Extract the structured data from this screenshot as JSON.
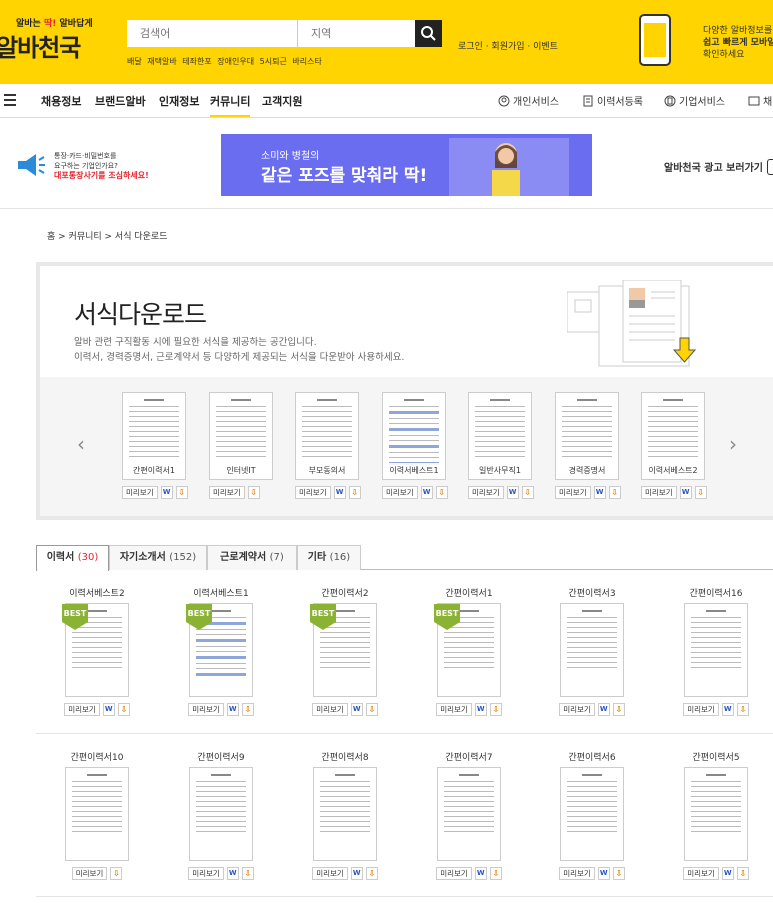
{
  "header": {
    "slogan_pre": "알바는 ",
    "slogan_red": "딱!",
    "slogan_post": " 알바답게",
    "logo": "알바천국",
    "search_placeholder": "검색어",
    "region_placeholder": "지역",
    "quick_links": [
      "배달",
      "재택알바",
      "테좌한포",
      "장애인우대",
      "5시퇴근",
      "바리스타"
    ],
    "account_links": "로그인 · 회원가입 · 이벤트",
    "promo_line1": "다양한 알바정보를",
    "promo_line2": "쉽고 빠르게 모바일",
    "promo_line3": "확인하세요"
  },
  "gnb": {
    "items": [
      "채용정보",
      "브랜드알바",
      "인재정보",
      "커뮤니티",
      "고객지원"
    ],
    "active": "커뮤니티",
    "right": [
      "개인서비스",
      "이력서등록",
      "기업서비스",
      "채"
    ]
  },
  "ad": {
    "warn_line1": "통장·카드·비밀번호를",
    "warn_line2": "요구하는 기업인가요?",
    "warn_line3": "대포통장사기를 조심하세요!",
    "banner_sub": "소미와 병철의",
    "banner_main": "같은 포즈를 맞춰라 딱!",
    "link": "알바천국 광고 보러가기"
  },
  "breadcrumb": "홈 > 커뮤니티 > 서식 다운로드",
  "hero": {
    "title": "서식다운로드",
    "desc1": "알바 관련 구직활동 시에 필요한 서식을 제공하는 공간입니다.",
    "desc2": "이력서, 경력증명서, 근로계약서 등 다양하게 제공되는 서식을 다운받아 사용하세요."
  },
  "carousel": {
    "prev": "‹",
    "next": "›",
    "items": [
      {
        "label": "간편이력서1",
        "hwp": true
      },
      {
        "label": "인터넷IT",
        "hwp": false
      },
      {
        "label": "부모동의서",
        "hwp": true
      },
      {
        "label": "이력서베스트1",
        "hwp": true
      },
      {
        "label": "일반사무직1",
        "hwp": true
      },
      {
        "label": "경력증명서",
        "hwp": true
      },
      {
        "label": "이력서베스트2",
        "hwp": true
      }
    ]
  },
  "actions": {
    "preview": "미리보기"
  },
  "tabs": [
    {
      "label": "이력서",
      "count": "(30)"
    },
    {
      "label": "자기소개서",
      "count": "(152)"
    },
    {
      "label": "근로계약서",
      "count": "(7)"
    },
    {
      "label": "기타",
      "count": "(16)"
    }
  ],
  "grid": [
    {
      "title": "이력서베스트2",
      "best": true,
      "hwp": true
    },
    {
      "title": "이력서베스트1",
      "best": true,
      "hwp": true
    },
    {
      "title": "간편이력서2",
      "best": true,
      "hwp": true
    },
    {
      "title": "간편이력서1",
      "best": true,
      "hwp": true
    },
    {
      "title": "간편이력서3",
      "best": false,
      "hwp": true
    },
    {
      "title": "간편이력서16",
      "best": false,
      "hwp": true
    },
    {
      "title": "간편이력서10",
      "best": false,
      "hwp": false
    },
    {
      "title": "간편이력서9",
      "best": false,
      "hwp": true
    },
    {
      "title": "간편이력서8",
      "best": false,
      "hwp": true
    },
    {
      "title": "간편이력서7",
      "best": false,
      "hwp": true
    },
    {
      "title": "간편이력서6",
      "best": false,
      "hwp": true
    },
    {
      "title": "간편이력서5",
      "best": false,
      "hwp": true
    }
  ],
  "colors": {
    "brand_yellow": "#ffd400",
    "banner_purple": "#6b6df0",
    "best_green": "#8bb333",
    "accent_red": "#e5242c"
  }
}
